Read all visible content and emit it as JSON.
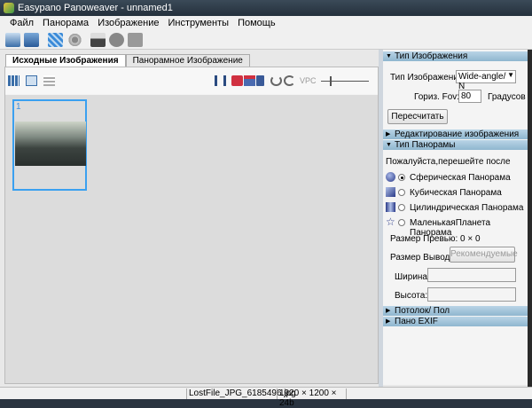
{
  "window": {
    "title": "Easypano Panoweaver - unnamed1"
  },
  "menu": [
    "Файл",
    "Панорама",
    "Изображение",
    "Инструменты",
    "Помощь"
  ],
  "toolbar_icons": [
    "open-images-icon",
    "add-images-icon",
    "stitch-icon",
    "settings-gear-icon",
    "save-icon",
    "publish-icon",
    "share-icon"
  ],
  "tabs": [
    {
      "label": "Исходные Изображения",
      "active": true
    },
    {
      "label": "Панорамное Изображение",
      "active": false
    }
  ],
  "image_toolbar": {
    "vpc_label": "VPC",
    "zoom_slider_value": 0.2
  },
  "images": [
    {
      "index": "1",
      "selected": true
    }
  ],
  "right": {
    "image_type_header": "Тип Изображения",
    "image_type_label": "Тип Изображения:",
    "image_type_value": "Wide-angle/ N",
    "fov_label": "Гориз. Fov:",
    "fov_value": "80",
    "fov_unit": "Градусов",
    "recalc_button": "Пересчитать",
    "edit_header": "Редактирование изображения",
    "pano_type_header": "Тип Панорамы",
    "hint": "Пожалуйста,перешейте после",
    "pano_types": [
      {
        "label": "Сферическая Панорама",
        "selected": true,
        "icon": "sphere-icon"
      },
      {
        "label": "Кубическая Панорама",
        "selected": false,
        "icon": "cube-icon"
      },
      {
        "label": "Цилиндрическая Панорама",
        "selected": false,
        "icon": "cylinder-icon"
      },
      {
        "label": "МаленькаяПланета Панорама",
        "selected": false,
        "icon": "star-icon"
      }
    ],
    "preview_size": "Размер Превью: 0 × 0",
    "output_size_label": "Размер Вывода:",
    "recommended_button": "Рекомендуемые",
    "width_label": "Ширина:",
    "width_value": "",
    "height_label": "Высота:",
    "height_value": "",
    "ceiling_header": "Потолок/ Пол",
    "exif_header": "Пано EXIF"
  },
  "status": {
    "filename": "LostFile_JPG_6185496.jpg",
    "dimensions": "1920 × 1200 × 24b"
  },
  "colors": {
    "selection": "#3aa0f0",
    "panel_header": "#a7c7dc"
  }
}
